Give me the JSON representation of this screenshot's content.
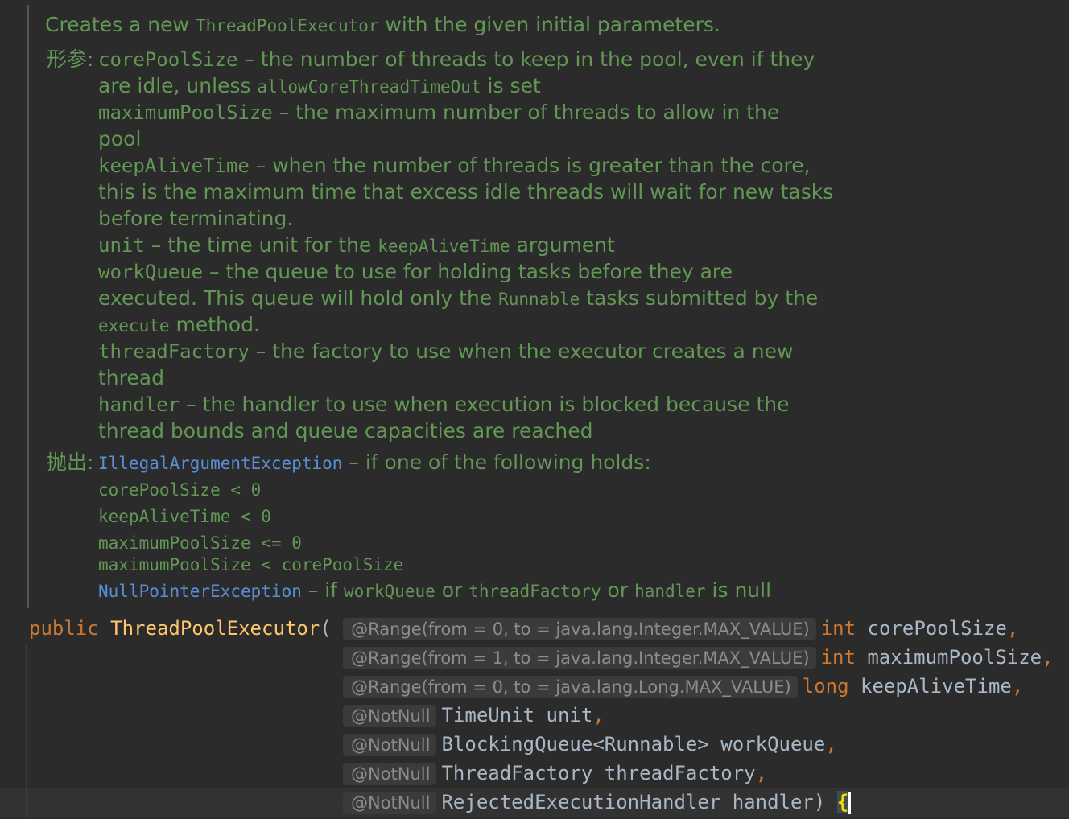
{
  "doc": {
    "summary_pre": "Creates a new ",
    "summary_code": "ThreadPoolExecutor",
    "summary_post": " with the given initial parameters.",
    "params_tag": "形参:",
    "throws_tag": "抛出:",
    "params": {
      "p1_name": "corePoolSize",
      "p1_desc": " – the number of threads to keep in the pool, even if they",
      "p1_l2_pre": "are idle, unless ",
      "p1_l2_code": "allowCoreThreadTimeOut",
      "p1_l2_post": " is set",
      "p2_name": "maximumPoolSize",
      "p2_desc": " – the maximum number of threads to allow in the",
      "p2_l2": "pool",
      "p3_name": "keepAliveTime",
      "p3_desc": " – when the number of threads is greater than the core,",
      "p3_l2": "this is the maximum time that excess idle threads will wait for new tasks",
      "p3_l3": "before terminating.",
      "p4_name": "unit",
      "p4_desc_pre": " – the time unit for the ",
      "p4_code": "keepAliveTime",
      "p4_desc_post": " argument",
      "p5_name": "workQueue",
      "p5_desc": " – the queue to use for holding tasks before they are",
      "p5_l2_pre": "executed. This queue will hold only the ",
      "p5_l2_code": "Runnable",
      "p5_l2_post": " tasks submitted by the",
      "p5_l3_code": "execute",
      "p5_l3_post": " method.",
      "p6_name": "threadFactory",
      "p6_desc": " – the factory to use when the executor creates a new",
      "p6_l2": "thread",
      "p7_name": "handler",
      "p7_desc": " – the handler to use when execution is blocked because the",
      "p7_l2": "thread bounds and queue capacities are reached"
    },
    "throws": {
      "ex1": "IllegalArgumentException",
      "ex1_desc": " – if one of the following holds:",
      "cond1": "corePoolSize < 0",
      "cond2": "keepAliveTime < 0",
      "cond3": "maximumPoolSize <= 0",
      "cond4": "maximumPoolSize < corePoolSize",
      "ex2": "NullPointerException",
      "ex2_dash": " – if ",
      "ex2_c1": "workQueue",
      "ex2_or1": " or ",
      "ex2_c2": "threadFactory",
      "ex2_or2": " or ",
      "ex2_c3": "handler",
      "ex2_post": " is null"
    }
  },
  "code": {
    "kw_public": "public",
    "ctor_name": "ThreadPoolExecutor",
    "open_paren": "(",
    "lines": [
      {
        "hint": "@Range(from = 0, to = java.lang.Integer.MAX_VALUE)",
        "type": "int",
        "name": "corePoolSize",
        "punct": ","
      },
      {
        "hint": "@Range(from = 1, to = java.lang.Integer.MAX_VALUE)",
        "type": "int",
        "name": "maximumPoolSize",
        "punct": ","
      },
      {
        "hint": "@Range(from = 0, to = java.lang.Long.MAX_VALUE)",
        "type": "long",
        "name": "keepAliveTime",
        "punct": ","
      },
      {
        "hint": "@NotNull",
        "type": "TimeUnit",
        "name": "unit",
        "punct": ","
      },
      {
        "hint": "@NotNull",
        "type": "BlockingQueue<Runnable>",
        "name": "workQueue",
        "punct": ","
      },
      {
        "hint": "@NotNull",
        "type": "ThreadFactory",
        "name": "threadFactory",
        "punct": ","
      },
      {
        "hint": "@NotNull",
        "type": "RejectedExecutionHandler",
        "name": "handler",
        "punct": ")"
      }
    ],
    "brace": "{"
  }
}
